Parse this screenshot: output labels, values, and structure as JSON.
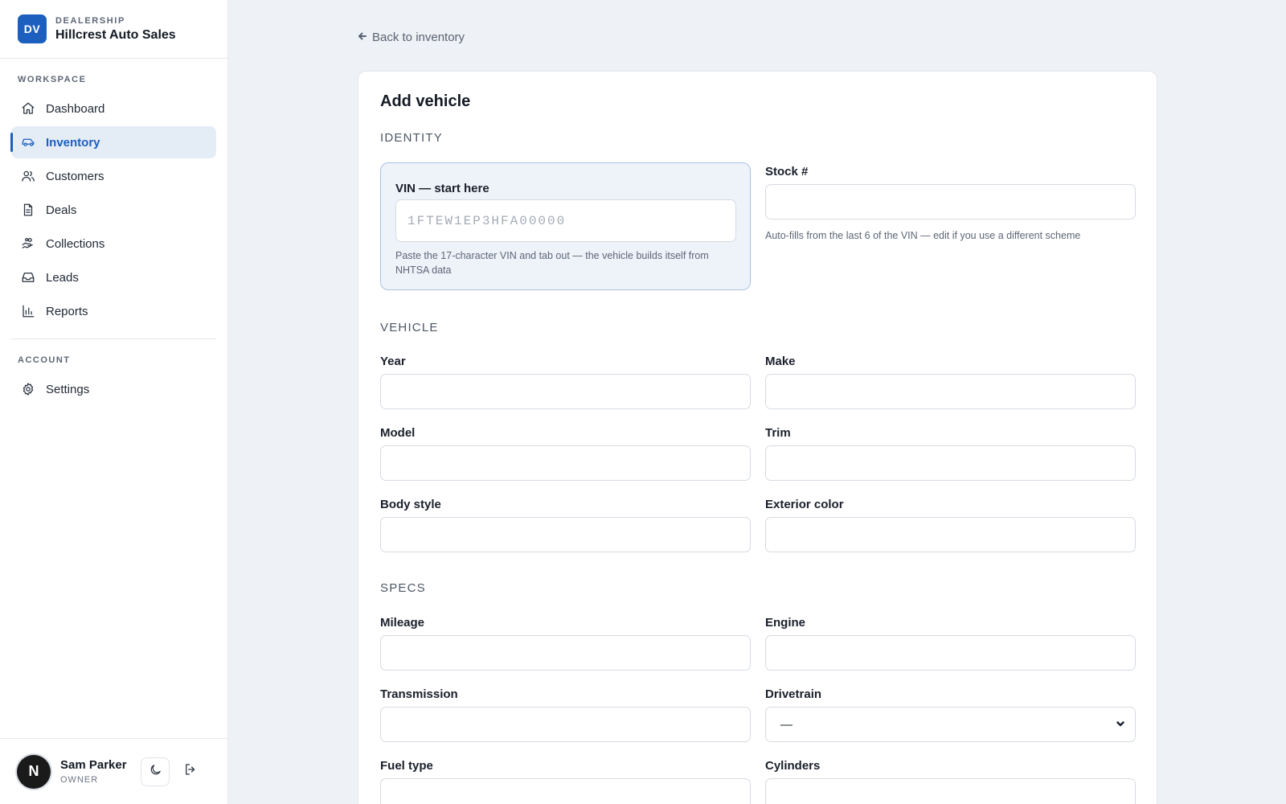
{
  "brand": {
    "logo": "DV",
    "kicker": "DEALERSHIP",
    "name": "Hillcrest Auto Sales"
  },
  "nav": {
    "workspace_heading": "WORKSPACE",
    "items": [
      {
        "label": "Dashboard",
        "icon": "home-icon"
      },
      {
        "label": "Inventory",
        "icon": "car-icon",
        "active": true
      },
      {
        "label": "Customers",
        "icon": "users-icon"
      },
      {
        "label": "Deals",
        "icon": "document-icon"
      },
      {
        "label": "Collections",
        "icon": "hand-coins-icon"
      },
      {
        "label": "Leads",
        "icon": "inbox-icon"
      },
      {
        "label": "Reports",
        "icon": "bar-chart-icon"
      }
    ],
    "account_heading": "ACCOUNT",
    "account_items": [
      {
        "label": "Settings",
        "icon": "gear-icon"
      }
    ]
  },
  "user": {
    "initial": "N",
    "name": "Sam Parker",
    "role": "OWNER"
  },
  "back_link": "Back to inventory",
  "form": {
    "title": "Add vehicle",
    "sections": {
      "identity": "IDENTITY",
      "vehicle": "VEHICLE",
      "specs": "SPECS"
    },
    "vin": {
      "label": "VIN — start here",
      "placeholder": "1FTEW1EP3HFA00000",
      "value": "",
      "help": "Paste the 17-character VIN and tab out — the vehicle builds itself from NHTSA data"
    },
    "stock": {
      "label": "Stock #",
      "value": "",
      "help": "Auto-fills from the last 6 of the VIN — edit if you use a different scheme"
    },
    "fields": {
      "year": {
        "label": "Year",
        "value": ""
      },
      "make": {
        "label": "Make",
        "value": ""
      },
      "model": {
        "label": "Model",
        "value": ""
      },
      "trim": {
        "label": "Trim",
        "value": ""
      },
      "body_style": {
        "label": "Body style",
        "value": ""
      },
      "exterior_color": {
        "label": "Exterior color",
        "value": ""
      },
      "mileage": {
        "label": "Mileage",
        "value": ""
      },
      "engine": {
        "label": "Engine",
        "value": ""
      },
      "transmission": {
        "label": "Transmission",
        "value": ""
      },
      "drivetrain": {
        "label": "Drivetrain",
        "selected": "—"
      },
      "fuel_type": {
        "label": "Fuel type",
        "value": ""
      },
      "cylinders": {
        "label": "Cylinders",
        "value": ""
      }
    }
  },
  "colors": {
    "accent": "#1c5fbf",
    "page_bg": "#eef1f5",
    "vin_bg": "#eef3fa"
  }
}
